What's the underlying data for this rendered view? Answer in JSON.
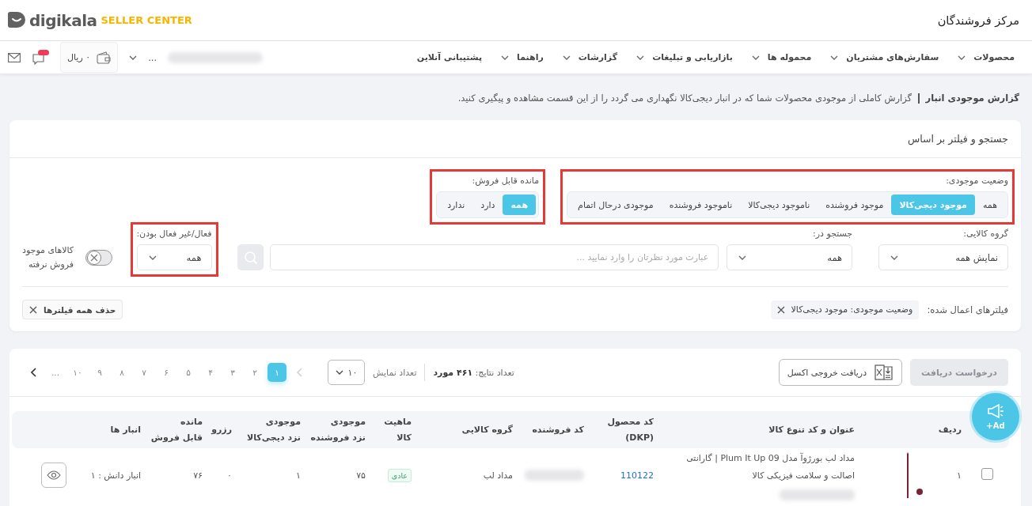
{
  "header": {
    "title": "مرکز فروشندگان",
    "logo_word": "digikala",
    "logo_tagline": "SELLER CENTER"
  },
  "nav": {
    "items": [
      {
        "label": "محصولات",
        "dropdown": true
      },
      {
        "label": "سفارش‌های مشتریان",
        "dropdown": true
      },
      {
        "label": "محموله ها",
        "dropdown": true
      },
      {
        "label": "بازاریابی و تبلیغات",
        "dropdown": true
      },
      {
        "label": "گزارشات",
        "dropdown": true
      },
      {
        "label": "راهنما",
        "dropdown": true
      },
      {
        "label": "پشتیبانی آنلاین",
        "dropdown": false
      }
    ],
    "account_more": "...",
    "wallet": "۰ ریال"
  },
  "page": {
    "title": "گزارش موجودی انبار",
    "description": "گزارش کاملی از موجودی محصولات شما که در انبار دیجی‌کالا نگهداری می گردد را از این قسمت مشاهده و پیگیری کنید."
  },
  "filters": {
    "title": "جستجو و فیلتر بر اساس",
    "stock_status": {
      "label": "وضعیت موجودی:",
      "highlighted": true,
      "options": [
        {
          "label": "همه",
          "selected": false
        },
        {
          "label": "موجود دیجی‌کالا",
          "selected": true
        },
        {
          "label": "موجود فروشنده",
          "selected": false
        },
        {
          "label": "ناموجود دیجی‌کالا",
          "selected": false
        },
        {
          "label": "ناموجود فروشنده",
          "selected": false
        },
        {
          "label": "موجودی درحال اتمام",
          "selected": false
        }
      ]
    },
    "sellable": {
      "label": "مانده قابل فروش:",
      "highlighted": true,
      "options": [
        {
          "label": "همه",
          "selected": true
        },
        {
          "label": "دارد",
          "selected": false
        },
        {
          "label": "ندارد",
          "selected": false
        }
      ]
    },
    "product_group": {
      "label": "گروه کالایی:",
      "value": "نمایش همه"
    },
    "search_in": {
      "label": "جستجو در:",
      "value": "همه"
    },
    "search": {
      "placeholder": "عبارت مورد نظرتان را وارد نمایید ..."
    },
    "active_status": {
      "label": "فعال/غیر فعال بودن:",
      "value": "همه",
      "highlighted": true
    },
    "unsold_toggle": {
      "label": "کالاهای موجود\nفروش نرفته",
      "on": false
    },
    "applied_label": "فیلترهای اعمال شده:",
    "applied": [
      "وضعیت موجودی: موجود دیجی‌کالا"
    ],
    "clear_all": "حذف همه فیلترها"
  },
  "results": {
    "request_button": {
      "label": "درخواست دریافت",
      "disabled": true
    },
    "excel_button": "دریافت خروجی اکسل",
    "count": "تعداد نتایج: **۴۶۱ مورد**",
    "page_size_label": "تعداد نمایش",
    "page_size": "۱۰",
    "previous_disabled": true,
    "pages": [
      {
        "label": "۱",
        "selected": true
      },
      {
        "label": "۲",
        "selected": false
      },
      {
        "label": "۳",
        "selected": false
      },
      {
        "label": "۴",
        "selected": false
      },
      {
        "label": "۵",
        "selected": false
      },
      {
        "label": "۶",
        "selected": false
      },
      {
        "label": "۷",
        "selected": false
      },
      {
        "label": "۸",
        "selected": false
      },
      {
        "label": "۹",
        "selected": false
      },
      {
        "label": "۱۰",
        "selected": false
      }
    ],
    "pages_more": "...",
    "table": {
      "columns": [
        "ردیف",
        "عنوان و کد تنوع کالا",
        "کد محصول\n(DKP)",
        "کد فروشنده",
        "گروه کالایی",
        "ماهیت\nکالا",
        "موجودی\nنزد فروشنده",
        "موجودی\nنزد دیجی‌کالا",
        "رزرو",
        "مانده\nقابل فروش",
        "انبار ها"
      ],
      "rows": [
        {
          "checked": false,
          "index": "۱",
          "title": "مداد لب بورژوآ مدل Plum It Up 09 | گارانتی اصالت و سلامت فیزیکی کالا",
          "dkp": "110122",
          "group": "مداد لب",
          "nature": "عادی",
          "seller_stock": "۷۵",
          "digikala_stock": "۱",
          "reserved": "۰",
          "sellable": "۷۶",
          "warehouses": "انبار دانش : ۱"
        }
      ]
    }
  },
  "ad_button": {
    "label": "+Ad"
  }
}
